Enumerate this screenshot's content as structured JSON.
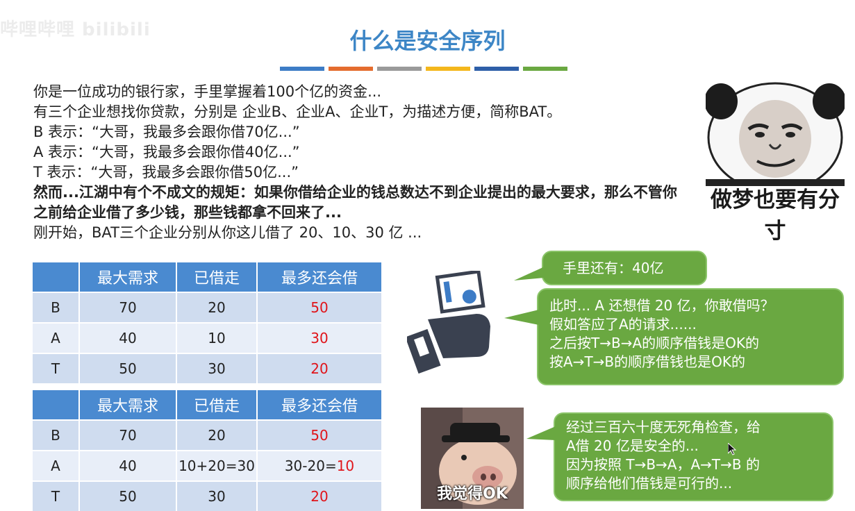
{
  "watermark": "哔哩哔哩 bilibili",
  "title": "什么是安全序列",
  "colors": [
    "#3d7cc6",
    "#e46c2e",
    "#9a9a9a",
    "#f4b71c",
    "#2e5fa8",
    "#6aa841"
  ],
  "lines": [
    "你是一位成功的银行家，手里掌握着100个亿的资金...",
    "有三个企业想找你贷款，分别是 企业B、企业A、企业T，为描述方便，简称BAT。",
    "B 表示：“大哥，我最多会跟你借70亿...”",
    "A 表示：“大哥，我最多会跟你借40亿...”",
    "T 表示：“大哥，我最多会跟你借50亿...”"
  ],
  "bold_text": "然而...江湖中有个不成文的规矩：如果你借给企业的钱总数达不到企业提出的最大要求，那么不管你之前给企业借了多少钱，那些钱都拿不回来了...",
  "last_line": "刚开始，BAT三个企业分别从你这儿借了 20、10、30 亿 ...",
  "panda_caption": "做梦也要有分寸",
  "table1": {
    "headers": [
      "",
      "最大需求",
      "已借走",
      "最多还会借"
    ],
    "rows": [
      [
        "B",
        "70",
        "20",
        "50"
      ],
      [
        "A",
        "40",
        "10",
        "30"
      ],
      [
        "T",
        "50",
        "30",
        "20"
      ]
    ]
  },
  "table2": {
    "headers": [
      "",
      "最大需求",
      "已借走",
      "最多还会借"
    ],
    "rows": [
      {
        "c0": "B",
        "c1": "70",
        "c2": "20",
        "c3a": "",
        "c3b": "50"
      },
      {
        "c0": "A",
        "c1": "40",
        "c2": "10+20=30",
        "c3a": "30-20=",
        "c3b": "10"
      },
      {
        "c0": "T",
        "c1": "50",
        "c2": "30",
        "c3a": "",
        "c3b": "20"
      }
    ]
  },
  "bubble1": "手里还有：40亿",
  "bubble2": [
    "此时... A 还想借 20 亿，你敢借吗？",
    "假如答应了A的请求......",
    "之后按T→B→A的顺序借钱是OK的",
    "按A→T→B的顺序借钱也是OK的"
  ],
  "bubble3": [
    "经过三百六十度无死角检查，给",
    "A借 20 亿是安全的...",
    "因为按照 T→B→A，A→T→B 的",
    "顺序给他们借钱是可行的..."
  ],
  "pig_caption": "我觉得OK"
}
